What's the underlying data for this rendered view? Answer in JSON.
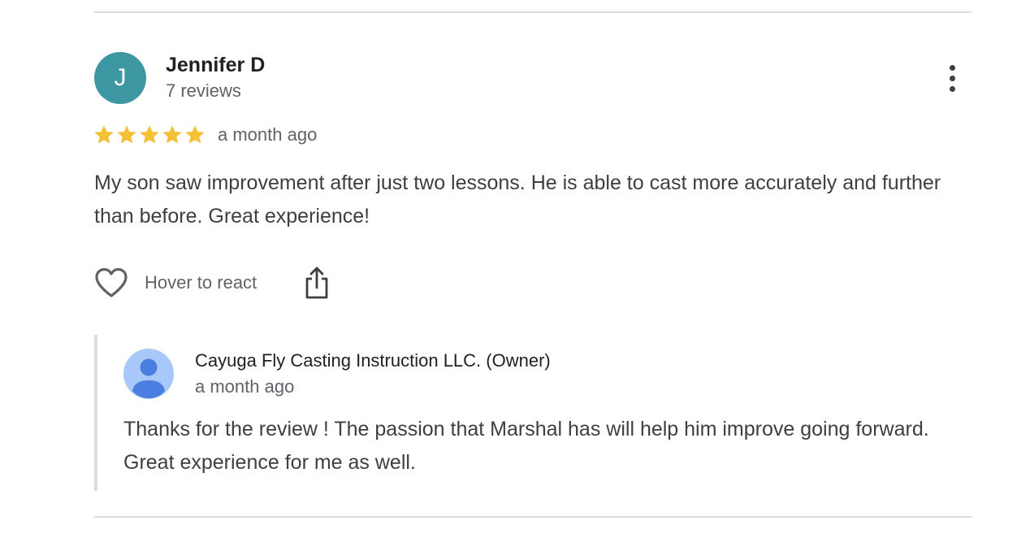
{
  "review": {
    "avatar_letter": "J",
    "avatar_color": "#3d97a3",
    "reviewer_name": "Jennifer D",
    "reviewer_meta": "7 reviews",
    "rating": 5,
    "rating_max": 5,
    "star_color": "#f4c036",
    "date": "a month ago",
    "text": "My son saw improvement after just two lessons. He is able to cast more accurately and further than before. Great experience!",
    "more_icon": "more-vert-icon"
  },
  "actions": {
    "react_icon": "heart-outline-icon",
    "react_label": "Hover to react",
    "share_icon": "share-icon"
  },
  "owner_reply": {
    "avatar_icon": "person-icon",
    "name": "Cayuga Fly Casting Instruction LLC. (Owner)",
    "date": "a month ago",
    "text": "Thanks for the review ! The passion that Marshal has will help him improve going forward. Great experience for me as well."
  }
}
